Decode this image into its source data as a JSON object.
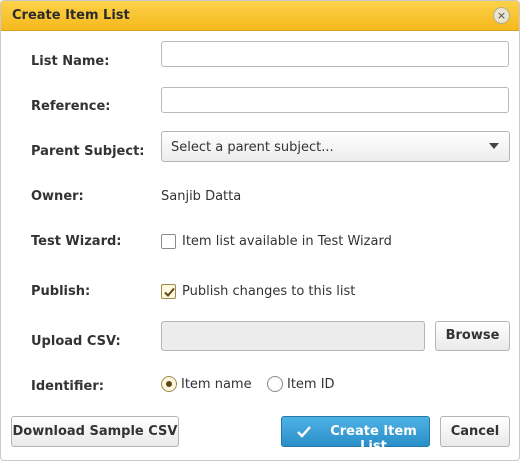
{
  "dialog": {
    "title": "Create Item List",
    "close_symbol": "×"
  },
  "form": {
    "list_name": {
      "label": "List Name:",
      "value": "",
      "placeholder": ""
    },
    "reference": {
      "label": "Reference:",
      "value": "",
      "placeholder": ""
    },
    "parent_subject": {
      "label": "Parent Subject:",
      "selected": "Select a parent subject..."
    },
    "owner": {
      "label": "Owner:",
      "value": "Sanjib Datta"
    },
    "test_wizard": {
      "label": "Test Wizard:",
      "option_label": "Item list available in Test Wizard",
      "checked": false
    },
    "publish": {
      "label": "Publish:",
      "option_label": "Publish changes to this list",
      "checked": true
    },
    "upload_csv": {
      "label": "Upload CSV:",
      "browse_label": "Browse"
    },
    "identifier": {
      "label": "Identifier:",
      "options": [
        {
          "label": "Item name",
          "selected": true
        },
        {
          "label": "Item ID",
          "selected": false
        }
      ]
    }
  },
  "footer": {
    "download_label": "Download Sample CSV",
    "create_label": "Create Item List",
    "cancel_label": "Cancel"
  },
  "colors": {
    "title_bar": "#f6b81c",
    "primary_button": "#2a8fc8"
  },
  "icons": {
    "close": "close-icon",
    "checkmark": "check-icon",
    "dropdown": "chevron-down-icon"
  }
}
